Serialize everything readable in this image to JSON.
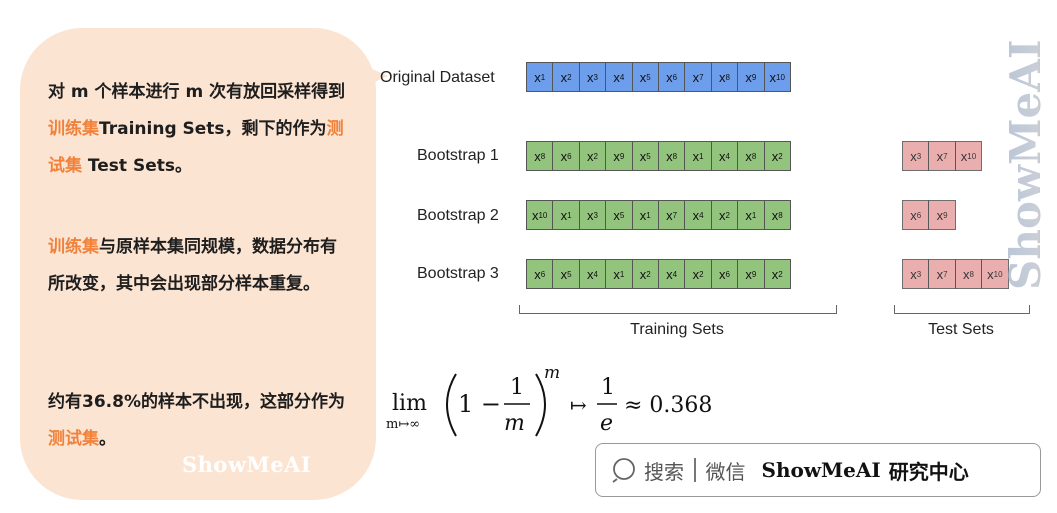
{
  "bubble": {
    "paragraphs": [
      {
        "parts": [
          {
            "text": "对 m 个样本进行 m 次有放回采样得到",
            "hl": false
          },
          {
            "text": "训练集",
            "hl": true
          },
          {
            "text": "Training Sets，剩下的作为",
            "hl": false
          },
          {
            "text": "测试集",
            "hl": true
          },
          {
            "text": " Test Sets。",
            "hl": false
          }
        ]
      },
      {
        "parts": [
          {
            "text": "训练集",
            "hl": true
          },
          {
            "text": "与原样本集同规模，数据分布有所改变，其中会出现部分样本重复。",
            "hl": false
          }
        ]
      },
      {
        "parts": [
          {
            "text": "约有36.8%的样本不出现，这部分作为",
            "hl": false
          },
          {
            "text": "测试集",
            "hl": true
          },
          {
            "text": "。",
            "hl": false
          }
        ]
      }
    ],
    "logo": "ShowMeAI"
  },
  "diagram": {
    "original": {
      "label": "Original Dataset",
      "cells": [
        "1",
        "2",
        "3",
        "4",
        "5",
        "6",
        "7",
        "8",
        "9",
        "10"
      ]
    },
    "bootstraps": [
      {
        "label": "Bootstrap 1",
        "train": [
          "8",
          "6",
          "2",
          "9",
          "5",
          "8",
          "1",
          "4",
          "8",
          "2"
        ],
        "test": [
          "3",
          "7",
          "10"
        ]
      },
      {
        "label": "Bootstrap 2",
        "train": [
          "10",
          "1",
          "3",
          "5",
          "1",
          "7",
          "4",
          "2",
          "1",
          "8"
        ],
        "test": [
          "6",
          "9"
        ]
      },
      {
        "label": "Bootstrap 3",
        "train": [
          "6",
          "5",
          "4",
          "1",
          "2",
          "4",
          "2",
          "6",
          "9",
          "2"
        ],
        "test": [
          "3",
          "7",
          "8",
          "10"
        ]
      }
    ],
    "cell_prefix": "x",
    "train_label": "Training Sets",
    "test_label": "Test Sets"
  },
  "formula": {
    "lim": "lim",
    "lim_sub": "m↦∞",
    "one_minus": "1 −",
    "num": "1",
    "den": "m",
    "exp": "m",
    "arrow": "↦",
    "num2": "1",
    "den2": "e",
    "approx": "≈ 0.368"
  },
  "search": {
    "label": "搜索",
    "wechat": "微信",
    "brand": "ShowMeAI",
    "center": "研究中心"
  },
  "watermark": "ShowMeAI",
  "colors": {
    "blue": "#6d9eeb",
    "green": "#93c47d",
    "red": "#e8a0a0",
    "highlight": "#f0823c",
    "bubble": "#fce4d2"
  }
}
